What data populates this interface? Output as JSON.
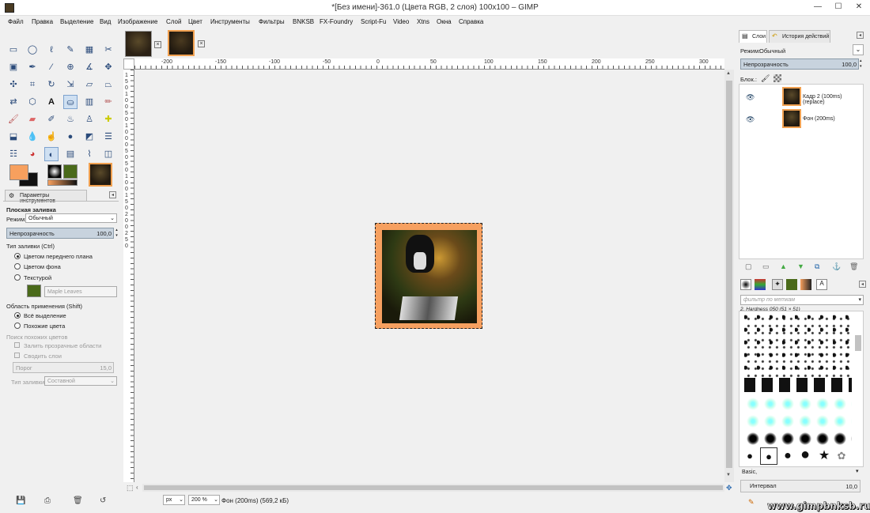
{
  "window": {
    "title": "*[Без имени]-361.0 (Цвета RGB, 2 слоя) 100x100 – GIMP",
    "minimize": "—",
    "maximize": "☐",
    "close": "✕"
  },
  "menu": [
    "Файл",
    "Правка",
    "Выделение",
    "Вид",
    "Изображение",
    "Слой",
    "Цвет",
    "Инструменты",
    "Фильтры",
    "BNKSB",
    "FX-Foundry",
    "Script-Fu",
    "Video",
    "Xtns",
    "Окна",
    "Справка"
  ],
  "tool_options": {
    "tab_label": "Параметры инструментов",
    "tool_name": "Плоская заливка",
    "mode_label": "Режим:",
    "mode_value": "Обычный",
    "opacity_label": "Непрозрачность",
    "opacity_value": "100,0",
    "fill_type_label": "Тип заливки (Ctrl)",
    "fill_fg": "Цветом переднего плана",
    "fill_bg": "Цветом фона",
    "fill_pattern": "Текстурой",
    "pattern_name": "Maple Leaves",
    "area_label": "Область применения (Shift)",
    "area_all": "Всё выделение",
    "area_similar": "Похожие цвета",
    "find_similar_label": "Поиск похожих цветов",
    "fill_transparent": "Залить прозрачные области",
    "sample_merged": "Сводить слои",
    "threshold_label": "Порог",
    "threshold_value": "15,0",
    "fill_by_label": "Тип заливки:",
    "fill_by_value": "Составной"
  },
  "rulers": {
    "h": [
      "-200",
      "-150",
      "-100",
      "-50",
      "0",
      "50",
      "100",
      "150",
      "200",
      "250",
      "300"
    ],
    "v": [
      "1",
      "5",
      "0",
      "1",
      "0",
      "0",
      "5",
      "0",
      "1",
      "0",
      "0",
      "0",
      "5",
      "0",
      "5",
      "0",
      "1",
      "0",
      "0",
      "1",
      "5",
      "0",
      "2",
      "0",
      "0",
      "2",
      "5",
      "0"
    ]
  },
  "status": {
    "unit": "px",
    "zoom": "200 %",
    "text": "Фон (200ms) (569,2 кБ)"
  },
  "layers_panel": {
    "tab_layers": "Слои",
    "tab_history": "История действий",
    "mode_label": "Режим:",
    "mode_value": "Обычный",
    "opacity_label": "Непрозрачность",
    "opacity_value": "100,0",
    "lock_label": "Блок.:",
    "layers": [
      {
        "name": "Кадр 2  (100ms)(replace)"
      },
      {
        "name": "Фон (200ms)"
      }
    ]
  },
  "brushes_panel": {
    "filter_placeholder": "фильтр по меткам",
    "brush_name": "2. Hardness 050 (51 × 51)",
    "preset": "Basic,",
    "spacing_label": "Интервал",
    "spacing_value": "10,0"
  },
  "watermark": "www.gimpbnksb.ru",
  "colors": {
    "foreground": "#f7a05e",
    "background": "#111111",
    "accent": "#7da2ce"
  }
}
